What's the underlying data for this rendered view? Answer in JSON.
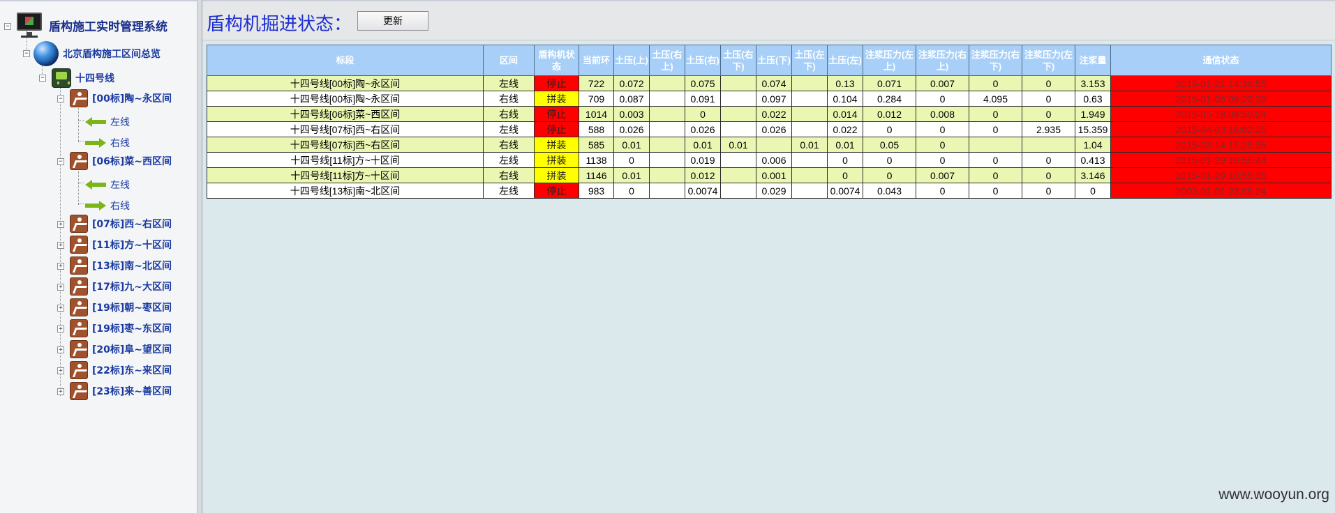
{
  "tree": {
    "root_label": "盾构施工实时管理系统",
    "overview_label": "北京盾构施工区间总览",
    "line_label": "十四号线",
    "sections": [
      {
        "label": "[00标]陶~永区间",
        "expanded": true,
        "children": [
          "左线",
          "右线"
        ]
      },
      {
        "label": "[06标]菜~西区间",
        "expanded": true,
        "children": [
          "左线",
          "右线"
        ]
      },
      {
        "label": "[07标]西~右区间",
        "expanded": false
      },
      {
        "label": "[11标]方~十区间",
        "expanded": false
      },
      {
        "label": "[13标]南~北区间",
        "expanded": false
      },
      {
        "label": "[17标]九~大区间",
        "expanded": false
      },
      {
        "label": "[19标]朝~枣区间",
        "expanded": false
      },
      {
        "label": "[19标]枣~东区间",
        "expanded": false
      },
      {
        "label": "[20标]阜~望区间",
        "expanded": false
      },
      {
        "label": "[22标]东~来区间",
        "expanded": false
      },
      {
        "label": "[23标]来~善区间",
        "expanded": false
      }
    ]
  },
  "main": {
    "title": "盾构机掘进状态：",
    "refresh_label": "更新",
    "watermark": "www.wooyun.org"
  },
  "table": {
    "headers": [
      "标段",
      "区间",
      "盾构机状态",
      "当前环",
      "土压(上)",
      "土压(右上)",
      "土压(右)",
      "土压(右下)",
      "土压(下)",
      "土压(左下)",
      "土压(左)",
      "注浆压力(左上)",
      "注浆压力(右上)",
      "注浆压力(右下)",
      "注浆压力(左下)",
      "注浆量",
      "通信状态"
    ],
    "rows": [
      [
        "十四号线[00标]陶~永区间",
        "左线",
        "停止",
        "722",
        "0.072",
        "",
        "0.075",
        "",
        "0.074",
        "",
        "0.13",
        "0.071",
        "0.007",
        "0",
        "0",
        "3.153",
        "2015-01-21 14:36:55"
      ],
      [
        "十四号线[00标]陶~永区间",
        "右线",
        "拼装",
        "709",
        "0.087",
        "",
        "0.091",
        "",
        "0.097",
        "",
        "0.104",
        "0.284",
        "0",
        "4.095",
        "0",
        "0.63",
        "2015-01-05 09:20:39"
      ],
      [
        "十四号线[06标]菜~西区间",
        "右线",
        "停止",
        "1014",
        "0.003",
        "",
        "0",
        "",
        "0.022",
        "",
        "0.014",
        "0.012",
        "0.008",
        "0",
        "0",
        "1.949",
        "2015-05-18 08:50:24"
      ],
      [
        "十四号线[07标]西~右区间",
        "左线",
        "停止",
        "588",
        "0.026",
        "",
        "0.026",
        "",
        "0.026",
        "",
        "0.022",
        "0",
        "0",
        "0",
        "2.935",
        "15.359",
        "2015-04-03 16:02:35"
      ],
      [
        "十四号线[07标]西~右区间",
        "右线",
        "拼装",
        "585",
        "0.01",
        "",
        "0.01",
        "0.01",
        "",
        "0.01",
        "0.01",
        "0.05",
        "0",
        "",
        "",
        "1.04",
        "2015-03-14 17:25:35"
      ],
      [
        "十四号线[11标]方~十区间",
        "左线",
        "拼装",
        "1138",
        "0",
        "",
        "0.019",
        "",
        "0.006",
        "",
        "0",
        "0",
        "0",
        "0",
        "0",
        "0.413",
        "2015-01-29 10:55:44"
      ],
      [
        "十四号线[11标]方~十区间",
        "右线",
        "拼装",
        "1146",
        "0.01",
        "",
        "0.012",
        "",
        "0.001",
        "",
        "0",
        "0",
        "0.007",
        "0",
        "0",
        "3.146",
        "2015-01-29 10:55:35"
      ],
      [
        "十四号线[13标]南~北区间",
        "左线",
        "停止",
        "983",
        "0",
        "",
        "0.0074",
        "",
        "0.029",
        "",
        "0.0074",
        "0.043",
        "0",
        "0",
        "0",
        "0",
        "2003-01-01 23:55:24"
      ]
    ],
    "status_colors": {
      "停止": "#ff0000",
      "拼装": "#ffff00"
    },
    "comm_color": "#ff0000",
    "row_colors": [
      "#e9f7b2",
      "#ffffff"
    ],
    "header_color": "#a7cff7"
  }
}
